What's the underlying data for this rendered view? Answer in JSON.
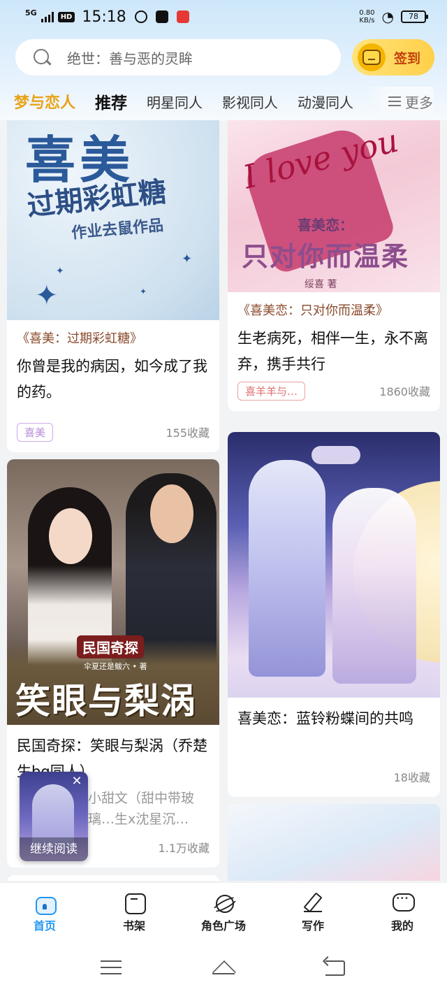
{
  "status_bar": {
    "network": "5G",
    "hd": "HD",
    "time": "15:18",
    "speed_value": "0.80",
    "speed_unit": "KB/s",
    "battery": "78"
  },
  "search": {
    "placeholder": "绝世：善与恶的灵眸",
    "checkin_label": "签到"
  },
  "tabs": [
    {
      "label": "梦与恋人"
    },
    {
      "label": "推荐"
    },
    {
      "label": "明星同人"
    },
    {
      "label": "影视同人"
    },
    {
      "label": "动漫同人"
    }
  ],
  "tabs_more": "更多",
  "cards": [
    {
      "cover": {
        "title": "喜美",
        "subtitle": "过期彩虹糖",
        "author": "作业去鼠作品"
      },
      "book_title": "《喜美：过期彩虹糖》",
      "text": "你曾是我的病因，如今成了我的药。",
      "tag": "喜美",
      "favorites": "155收藏"
    },
    {
      "cover": {
        "script": "I love you",
        "line1": "喜美恋：",
        "line2": "只对你而温柔",
        "credit": "绥喜  著"
      },
      "book_title": "《喜美恋：只对你而温柔》",
      "text": "生老病死，相伴一生，永不离弃，携手共行",
      "tag": "喜羊羊与…",
      "favorites": "1860收藏"
    },
    {
      "cover": {
        "series": "民国奇探",
        "author": "伞夏还是鲅六 • 著",
        "title": "笑眼与梨涡"
      },
      "text": "民国奇探：笑眼与梨涡（乔楚生bg同人）",
      "desc": "小甜文（甜中带玻璃…生x沈星沉…",
      "favorites": "1.1万收藏"
    },
    {
      "text": "喜美恋：蓝铃粉蝶间的共鸣",
      "favorites": "18收藏"
    }
  ],
  "float_read": {
    "label": "继续阅读",
    "close": "✕"
  },
  "bottom_nav": [
    {
      "label": "首页",
      "icon": "home-icon"
    },
    {
      "label": "书架",
      "icon": "bookshelf-icon"
    },
    {
      "label": "角色广场",
      "icon": "planet-icon"
    },
    {
      "label": "写作",
      "icon": "pen-icon"
    },
    {
      "label": "我的",
      "icon": "message-icon"
    }
  ],
  "colors": {
    "accent": "#e8a317",
    "nav_active": "#2196f3",
    "tag_purple": "#b98bd8",
    "tag_red": "#e07070"
  }
}
